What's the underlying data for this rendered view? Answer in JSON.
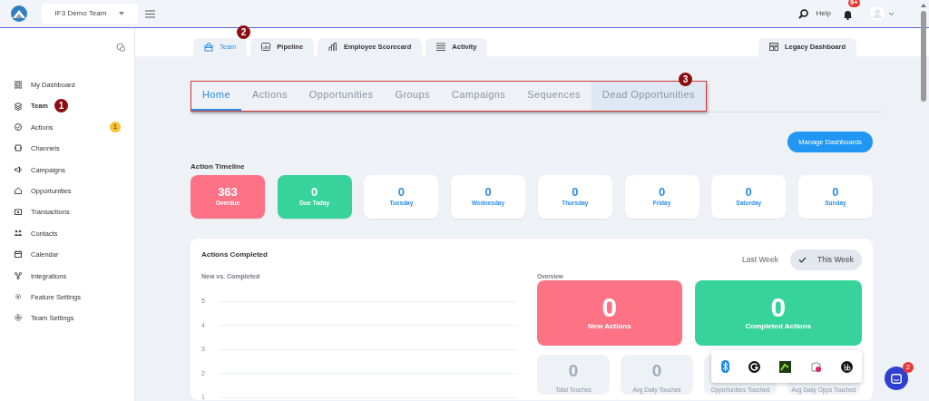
{
  "topbar": {
    "team_select": "IF3 Demo Team",
    "help": "Help",
    "notifications": "9+"
  },
  "sidebar": {
    "items": [
      {
        "label": "My Dashboard",
        "selected": false
      },
      {
        "label": "Team",
        "selected": true,
        "marker": "1"
      },
      {
        "label": "Actions",
        "selected": false,
        "badge": "1"
      },
      {
        "label": "Channels",
        "selected": false
      },
      {
        "label": "Campaigns",
        "selected": false
      },
      {
        "label": "Opportunities",
        "selected": false
      },
      {
        "label": "Transactions",
        "selected": false
      },
      {
        "label": "Contacts",
        "selected": false
      },
      {
        "label": "Calendar",
        "selected": false
      },
      {
        "label": "Integrations",
        "selected": false
      },
      {
        "label": "Feature Settings",
        "selected": false
      },
      {
        "label": "Team Settings",
        "selected": false
      }
    ]
  },
  "tabs": [
    {
      "label": "Team",
      "selected": true,
      "marker": "2"
    },
    {
      "label": "Pipeline",
      "selected": false
    },
    {
      "label": "Employee Scorecard",
      "selected": false
    },
    {
      "label": "Activity",
      "selected": false
    },
    {
      "label": "Legacy Dashboard",
      "selected": false
    }
  ],
  "subtabs": {
    "marker": "3",
    "items": [
      {
        "label": "Home",
        "selected": true
      },
      {
        "label": "Actions",
        "selected": false
      },
      {
        "label": "Opportunities",
        "selected": false
      },
      {
        "label": "Groups",
        "selected": false
      },
      {
        "label": "Campaigns",
        "selected": false
      },
      {
        "label": "Sequences",
        "selected": false
      },
      {
        "label": "Dead Opportunities",
        "selected": false,
        "hovered": true
      }
    ]
  },
  "manage_button": "Manage Dashboards",
  "timeline": {
    "title": "Action Timeline",
    "cards": [
      {
        "kind": "overdue",
        "value": "363",
        "label": "Overdue"
      },
      {
        "kind": "due",
        "value": "0",
        "label": "Due Today"
      },
      {
        "kind": "day",
        "value": "0",
        "label": "Tuesday"
      },
      {
        "kind": "day",
        "value": "0",
        "label": "Wednesday"
      },
      {
        "kind": "day",
        "value": "0",
        "label": "Thursday"
      },
      {
        "kind": "day",
        "value": "0",
        "label": "Friday"
      },
      {
        "kind": "day",
        "value": "0",
        "label": "Saturday"
      },
      {
        "kind": "day",
        "value": "0",
        "label": "Sunday"
      }
    ]
  },
  "actions_completed": {
    "title": "Actions Completed",
    "range": [
      {
        "label": "Last Week",
        "selected": false
      },
      {
        "label": "This Week",
        "selected": true
      }
    ],
    "chart": {
      "title": "New vs. Completed",
      "y_ticks": [
        "5",
        "4",
        "3",
        "2",
        "1"
      ]
    },
    "overview": {
      "title": "Overview",
      "cards": [
        {
          "kind": "new",
          "value": "0",
          "label": "New Actions"
        },
        {
          "kind": "completed",
          "value": "0",
          "label": "Completed Actions"
        }
      ],
      "stats": [
        {
          "value": "0",
          "label": "Total Touches"
        },
        {
          "value": "0",
          "label": "Avg Daily Touches"
        },
        {
          "label": "Opportunities Touched"
        },
        {
          "label": "Avg Daily Opps Touched"
        }
      ]
    }
  },
  "chat": {
    "badge": "2"
  }
}
